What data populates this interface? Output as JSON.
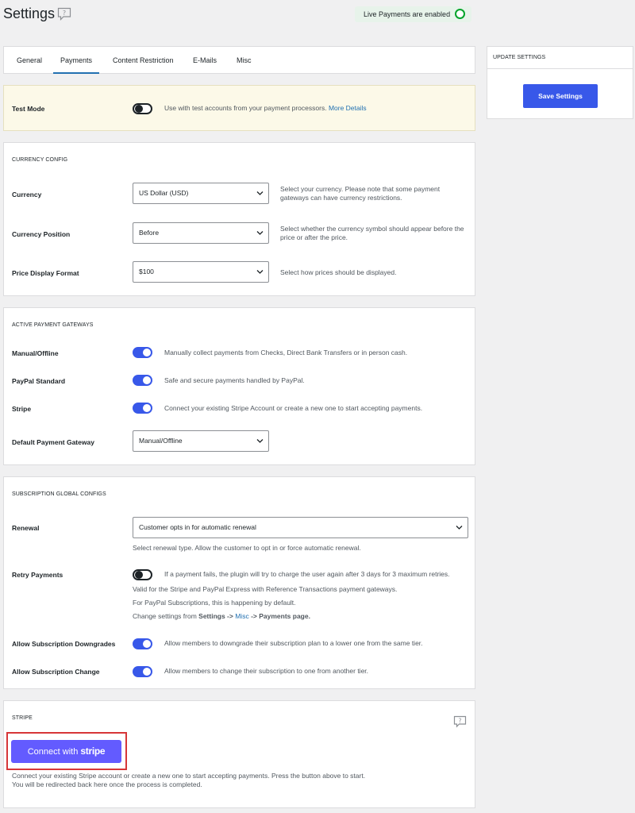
{
  "header": {
    "title": "Settings",
    "live_status": "Live Payments are enabled"
  },
  "tabs": [
    {
      "label": "General"
    },
    {
      "label": "Payments",
      "active": true
    },
    {
      "label": "Content Restriction"
    },
    {
      "label": "E-Mails"
    },
    {
      "label": "Misc"
    }
  ],
  "test_mode": {
    "label": "Test Mode",
    "enabled": false,
    "description": "Use with test accounts from your payment processors.",
    "link": "More Details"
  },
  "currency_config": {
    "title": "CURRENCY CONFIG",
    "currency": {
      "label": "Currency",
      "value": "US Dollar (USD)",
      "description": "Select your currency. Please note that some payment gateways can have currency restrictions."
    },
    "position": {
      "label": "Currency Position",
      "value": "Before",
      "description": "Select whether the currency symbol should appear before the price or after the price."
    },
    "format": {
      "label": "Price Display Format",
      "value": "$100",
      "description": "Select how prices should be displayed."
    }
  },
  "gateways": {
    "title": "ACTIVE PAYMENT GATEWAYS",
    "manual": {
      "label": "Manual/Offline",
      "enabled": true,
      "description": "Manually collect payments from Checks, Direct Bank Transfers or in person cash."
    },
    "paypal": {
      "label": "PayPal Standard",
      "enabled": true,
      "description": "Safe and secure payments handled by PayPal."
    },
    "stripe": {
      "label": "Stripe",
      "enabled": true,
      "description": "Connect your existing Stripe Account or create a new one to start accepting payments."
    },
    "default": {
      "label": "Default Payment Gateway",
      "value": "Manual/Offline"
    }
  },
  "subscription": {
    "title": "SUBSCRIPTION GLOBAL CONFIGS",
    "renewal": {
      "label": "Renewal",
      "value": "Customer opts in for automatic renewal",
      "description": "Select renewal type. Allow the customer to opt in or force automatic renewal."
    },
    "retry": {
      "label": "Retry Payments",
      "enabled": false,
      "description": "If a payment fails, the plugin will try to charge the user again after 3 days for 3 maximum retries.",
      "note1": "Valid for the Stripe and PayPal Express with Reference Transactions payment gateways.",
      "note2": "For PayPal Subscriptions, this is happening by default.",
      "note3_prefix": "Change settings from ",
      "note3_settings": "Settings",
      "note3_arrow1": " -> ",
      "note3_misc": "Misc",
      "note3_arrow2": " -> ",
      "note3_payments": "Payments page."
    },
    "downgrades": {
      "label": "Allow Subscription Downgrades",
      "enabled": true,
      "description": "Allow members to downgrade their subscription plan to a lower one from the same tier."
    },
    "change": {
      "label": "Allow Subscription Change",
      "enabled": true,
      "description": "Allow members to change their subscription to one from another tier."
    }
  },
  "stripe_section": {
    "title": "STRIPE",
    "button_prefix": "Connect with",
    "button_brand": "stripe",
    "description1": "Connect your existing Stripe account or create a new one to start accepting payments. Press the button above to start.",
    "description2": "You will be redirected back here once the process is completed."
  },
  "update_panel": {
    "title": "UPDATE SETTINGS",
    "save_label": "Save Settings"
  },
  "colors": {
    "accent": "#3858e9",
    "stripe": "#635bff",
    "live": "#00a32a",
    "highlight": "#d63638"
  }
}
